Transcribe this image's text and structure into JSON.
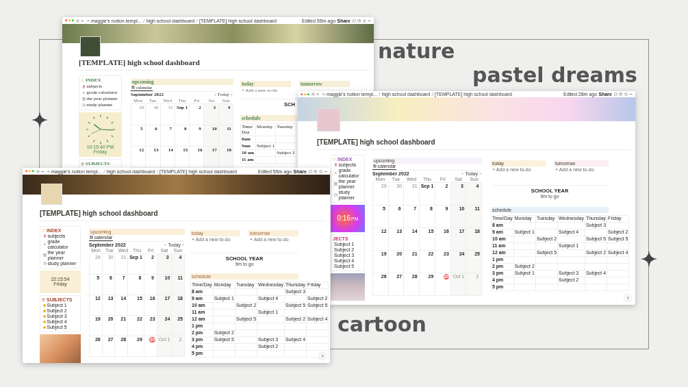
{
  "labels": [
    {
      "text": "nature"
    },
    {
      "text": "pastel dreams"
    },
    {
      "text": "cartoon"
    }
  ],
  "windows": [
    {
      "kind": "nature",
      "breadcrumbs": [
        "maggie's notion templ...",
        "high school dashboard",
        "[TEMPLATE] high school dashboard"
      ],
      "separator": "/",
      "edited": "Edited 55m ago",
      "share": "Share",
      "title": "[TEMPLATE] high school dashboard",
      "index": {
        "heading": "INDEX",
        "items": [
          "subjects",
          "grade calculator",
          "the year planner",
          "study planner"
        ]
      },
      "clock": {
        "time": "10:15:40 PM",
        "day": "Friday"
      },
      "subjects": {
        "heading": "SUBJECTS"
      },
      "upcoming": {
        "heading": "upcoming",
        "tab": "calendar",
        "month": "September 2022",
        "today_button": "Today",
        "weekdays": [
          "Mon",
          "Tue",
          "Wed",
          "Thu",
          "Fri",
          "Sat",
          "Sun"
        ],
        "weeks": [
          [
            {
              "d": "29",
              "muted": true,
              "today": false
            },
            {
              "d": "30",
              "muted": true,
              "today": false
            },
            {
              "d": "31",
              "muted": true,
              "today": false
            },
            {
              "d": "Sep 1",
              "muted": false,
              "today": false
            },
            {
              "d": "2",
              "muted": false,
              "today": false
            },
            {
              "d": "3",
              "muted": false,
              "today": false
            },
            {
              "d": "4",
              "muted": false,
              "today": false
            }
          ],
          [
            {
              "d": "5",
              "muted": false,
              "today": false
            },
            {
              "d": "6",
              "muted": false,
              "today": false
            },
            {
              "d": "7",
              "muted": false,
              "today": false
            },
            {
              "d": "8",
              "muted": false,
              "today": false
            },
            {
              "d": "9",
              "muted": false,
              "today": false
            },
            {
              "d": "10",
              "muted": false,
              "today": false
            },
            {
              "d": "11",
              "muted": false,
              "today": false
            }
          ],
          [
            {
              "d": "12",
              "muted": false,
              "today": false
            },
            {
              "d": "13",
              "muted": false,
              "today": false
            },
            {
              "d": "14",
              "muted": false,
              "today": false
            },
            {
              "d": "15",
              "muted": false,
              "today": false
            },
            {
              "d": "16",
              "muted": false,
              "today": false
            },
            {
              "d": "17",
              "muted": false,
              "today": false
            },
            {
              "d": "18",
              "muted": false,
              "today": false
            }
          ]
        ]
      },
      "today": {
        "heading": "today",
        "add": "+ Add a new to-do"
      },
      "tomorrow": {
        "heading": "tomorrow"
      },
      "school_year": {
        "title": "SCH"
      },
      "schedule": {
        "heading": "schedule",
        "columns": [
          "Time/Day",
          "Monday",
          "Tuesday"
        ],
        "rows": [
          {
            "cells": [
              "8am",
              "",
              ""
            ]
          },
          {
            "cells": [
              "9am",
              "Subject 1",
              ""
            ]
          },
          {
            "cells": [
              "10 am",
              "",
              "Subject 2"
            ]
          },
          {
            "cells": [
              "11 am",
              "",
              ""
            ]
          }
        ]
      }
    },
    {
      "kind": "pastel",
      "breadcrumbs": [
        "maggie's notion templ...",
        "high school dashboard",
        "[TEMPLATE] high school dashboard"
      ],
      "separator": "/",
      "edited": "Edited 28m ago",
      "share": "Share",
      "title": "[TEMPLATE] high school dashboard",
      "index": {
        "heading": "INDEX",
        "items": [
          "subjects",
          "grade calculator",
          "the year planner",
          "study planner"
        ]
      },
      "clock": {
        "time": "0:16",
        "suffix": "PM"
      },
      "subjects": {
        "heading": "JECTS",
        "items": [
          "Subject 1",
          "Subject 2",
          "Subject 3",
          "Subject 4",
          "Subject 5"
        ]
      },
      "photo": true,
      "upcoming": {
        "heading": "upcoming",
        "tab": "calendar",
        "month": "September 2022",
        "today_button": "Today",
        "weekdays": [
          "Mon",
          "Tue",
          "Wed",
          "Thu",
          "Fri",
          "Sat",
          "Sun"
        ],
        "weeks": [
          [
            {
              "d": "29",
              "muted": true,
              "today": false
            },
            {
              "d": "30",
              "muted": true,
              "today": false
            },
            {
              "d": "31",
              "muted": true,
              "today": false
            },
            {
              "d": "Sep 1",
              "muted": false,
              "today": false
            },
            {
              "d": "2",
              "muted": false,
              "today": false
            },
            {
              "d": "3",
              "muted": false,
              "today": false
            },
            {
              "d": "4",
              "muted": false,
              "today": false
            }
          ],
          [
            {
              "d": "5",
              "muted": false,
              "today": false
            },
            {
              "d": "6",
              "muted": false,
              "today": false
            },
            {
              "d": "7",
              "muted": false,
              "today": false
            },
            {
              "d": "8",
              "muted": false,
              "today": false
            },
            {
              "d": "9",
              "muted": false,
              "today": false
            },
            {
              "d": "10",
              "muted": false,
              "today": false
            },
            {
              "d": "11",
              "muted": false,
              "today": false
            }
          ],
          [
            {
              "d": "12",
              "muted": false,
              "today": false
            },
            {
              "d": "13",
              "muted": false,
              "today": false
            },
            {
              "d": "14",
              "muted": false,
              "today": false
            },
            {
              "d": "15",
              "muted": false,
              "today": false
            },
            {
              "d": "16",
              "muted": false,
              "today": false
            },
            {
              "d": "17",
              "muted": false,
              "today": false
            },
            {
              "d": "18",
              "muted": false,
              "today": false
            }
          ],
          [
            {
              "d": "19",
              "muted": false,
              "today": false
            },
            {
              "d": "20",
              "muted": false,
              "today": false
            },
            {
              "d": "21",
              "muted": false,
              "today": false
            },
            {
              "d": "22",
              "muted": false,
              "today": false
            },
            {
              "d": "23",
              "muted": false,
              "today": false
            },
            {
              "d": "24",
              "muted": false,
              "today": false
            },
            {
              "d": "25",
              "muted": false,
              "today": false
            }
          ],
          [
            {
              "d": "26",
              "muted": false,
              "today": false
            },
            {
              "d": "27",
              "muted": false,
              "today": false
            },
            {
              "d": "28",
              "muted": false,
              "today": false
            },
            {
              "d": "29",
              "muted": false,
              "today": false
            },
            {
              "d": "30",
              "muted": false,
              "today": true
            },
            {
              "d": "Oct 1",
              "muted": true,
              "today": false
            },
            {
              "d": "2",
              "muted": true,
              "today": false
            }
          ]
        ]
      },
      "today": {
        "heading": "today",
        "add": "+ Add a new to-do"
      },
      "tomorrow": {
        "heading": "tomorrow",
        "add": "+ Add a new to-do"
      },
      "school_year": {
        "title": "SCHOOL YEAR",
        "subtitle": "9m to go"
      },
      "schedule": {
        "heading": "schedule",
        "columns": [
          "Time/Day",
          "Monday",
          "Tuesday",
          "Wednesday",
          "Thursday",
          "Friday"
        ],
        "rows": [
          {
            "cells": [
              "8 am",
              "",
              "",
              "",
              "Subject 3",
              ""
            ]
          },
          {
            "cells": [
              "9 am",
              "Subject 1",
              "",
              "Subject 4",
              "",
              "Subject 2"
            ]
          },
          {
            "cells": [
              "10 am",
              "",
              "Subject 2",
              "",
              "Subject 5",
              "Subject 5"
            ]
          },
          {
            "cells": [
              "11 am",
              "",
              "",
              "Subject 1",
              "",
              ""
            ]
          },
          {
            "cells": [
              "12 am",
              "",
              "Subject 5",
              "",
              "Subject 2",
              "Subject 4"
            ]
          },
          {
            "cells": [
              "1 pm",
              "",
              "",
              "",
              "",
              ""
            ]
          },
          {
            "cells": [
              "2 pm",
              "Subject 2",
              "",
              "",
              "",
              ""
            ]
          },
          {
            "cells": [
              "3 pm",
              "Subject 1",
              "",
              "Subject 3",
              "Subject 4",
              ""
            ]
          },
          {
            "cells": [
              "4 pm",
              "",
              "",
              "Subject 2",
              "",
              ""
            ]
          },
          {
            "cells": [
              "5 pm",
              "",
              "",
              "",
              "",
              ""
            ]
          }
        ]
      },
      "help": "?"
    },
    {
      "kind": "cartoon",
      "breadcrumbs": [
        "maggie's notion templ...",
        "high school dashboard",
        "[TEMPLATE] high school dashboard"
      ],
      "separator": "/",
      "edited": "Edited 55m ago",
      "share": "Share",
      "title": "[TEMPLATE] high school dashboard",
      "index": {
        "heading": "INDEX",
        "items": [
          "subjects",
          "grade calculator",
          "the year planner",
          "study planner"
        ]
      },
      "clock": {
        "time": "22:15:54",
        "day": "Friday"
      },
      "subjects": {
        "heading": "SUBJECTS",
        "items": [
          "Subject 1",
          "Subject 2",
          "Subject 3",
          "Subject 4",
          "Subject 5"
        ]
      },
      "photo": true,
      "upcoming": {
        "heading": "upcoming",
        "tab": "calendar",
        "month": "September 2022",
        "today_button": "Today",
        "weekdays": [
          "Mon",
          "Tue",
          "Wed",
          "Thu",
          "Fri",
          "Sat",
          "Sun"
        ],
        "weeks": [
          [
            {
              "d": "29",
              "muted": true,
              "today": false
            },
            {
              "d": "30",
              "muted": true,
              "today": false
            },
            {
              "d": "31",
              "muted": true,
              "today": false
            },
            {
              "d": "Sep 1",
              "muted": false,
              "today": false
            },
            {
              "d": "2",
              "muted": false,
              "today": false
            },
            {
              "d": "3",
              "muted": false,
              "today": false
            },
            {
              "d": "4",
              "muted": false,
              "today": false
            }
          ],
          [
            {
              "d": "5",
              "muted": false,
              "today": false
            },
            {
              "d": "6",
              "muted": false,
              "today": false
            },
            {
              "d": "7",
              "muted": false,
              "today": false
            },
            {
              "d": "8",
              "muted": false,
              "today": false
            },
            {
              "d": "9",
              "muted": false,
              "today": false
            },
            {
              "d": "10",
              "muted": false,
              "today": false
            },
            {
              "d": "11",
              "muted": false,
              "today": false
            }
          ],
          [
            {
              "d": "12",
              "muted": false,
              "today": false
            },
            {
              "d": "13",
              "muted": false,
              "today": false
            },
            {
              "d": "14",
              "muted": false,
              "today": false
            },
            {
              "d": "15",
              "muted": false,
              "today": false
            },
            {
              "d": "16",
              "muted": false,
              "today": false
            },
            {
              "d": "17",
              "muted": false,
              "today": false
            },
            {
              "d": "18",
              "muted": false,
              "today": false
            }
          ],
          [
            {
              "d": "19",
              "muted": false,
              "today": false
            },
            {
              "d": "20",
              "muted": false,
              "today": false
            },
            {
              "d": "21",
              "muted": false,
              "today": false
            },
            {
              "d": "22",
              "muted": false,
              "today": false
            },
            {
              "d": "23",
              "muted": false,
              "today": false
            },
            {
              "d": "24",
              "muted": false,
              "today": false
            },
            {
              "d": "25",
              "muted": false,
              "today": false
            }
          ],
          [
            {
              "d": "26",
              "muted": false,
              "today": false
            },
            {
              "d": "27",
              "muted": false,
              "today": false
            },
            {
              "d": "28",
              "muted": false,
              "today": false
            },
            {
              "d": "29",
              "muted": false,
              "today": false
            },
            {
              "d": "30",
              "muted": false,
              "today": true
            },
            {
              "d": "Oct 1",
              "muted": true,
              "today": false
            },
            {
              "d": "2",
              "muted": true,
              "today": false
            }
          ]
        ]
      },
      "today": {
        "heading": "today",
        "add": "+ Add a new to-do"
      },
      "tomorrow": {
        "heading": "tomorrow",
        "add": "+ Add a new to-do"
      },
      "school_year": {
        "title": "SCHOOL YEAR",
        "subtitle": "9m to go"
      },
      "schedule": {
        "heading": "schedule",
        "columns": [
          "Time/Day",
          "Monday",
          "Tuesday",
          "Wednesday",
          "Thursday",
          "Friday"
        ],
        "rows": [
          {
            "cells": [
              "8 am",
              "",
              "",
              "",
              "Subject 3",
              ""
            ]
          },
          {
            "cells": [
              "9 am",
              "Subject 1",
              "",
              "Subject 4",
              "",
              "Subject 2"
            ]
          },
          {
            "cells": [
              "10 am",
              "",
              "Subject 2",
              "",
              "Subject 5",
              "Subject 5"
            ]
          },
          {
            "cells": [
              "11 am",
              "",
              "",
              "Subject 1",
              "",
              ""
            ]
          },
          {
            "cells": [
              "12 am",
              "",
              "Subject 5",
              "",
              "Subject 2",
              "Subject 4"
            ]
          },
          {
            "cells": [
              "1 pm",
              "",
              "",
              "",
              "",
              ""
            ]
          },
          {
            "cells": [
              "2 pm",
              "Subject 2",
              "",
              "",
              "",
              ""
            ]
          },
          {
            "cells": [
              "3 pm",
              "Subject 5",
              "",
              "Subject 3",
              "Subject 4",
              ""
            ]
          },
          {
            "cells": [
              "4 pm",
              "",
              "",
              "Subject 2",
              "",
              ""
            ]
          },
          {
            "cells": [
              "5 pm",
              "",
              "",
              "",
              "",
              ""
            ]
          }
        ]
      },
      "help": "?"
    }
  ]
}
